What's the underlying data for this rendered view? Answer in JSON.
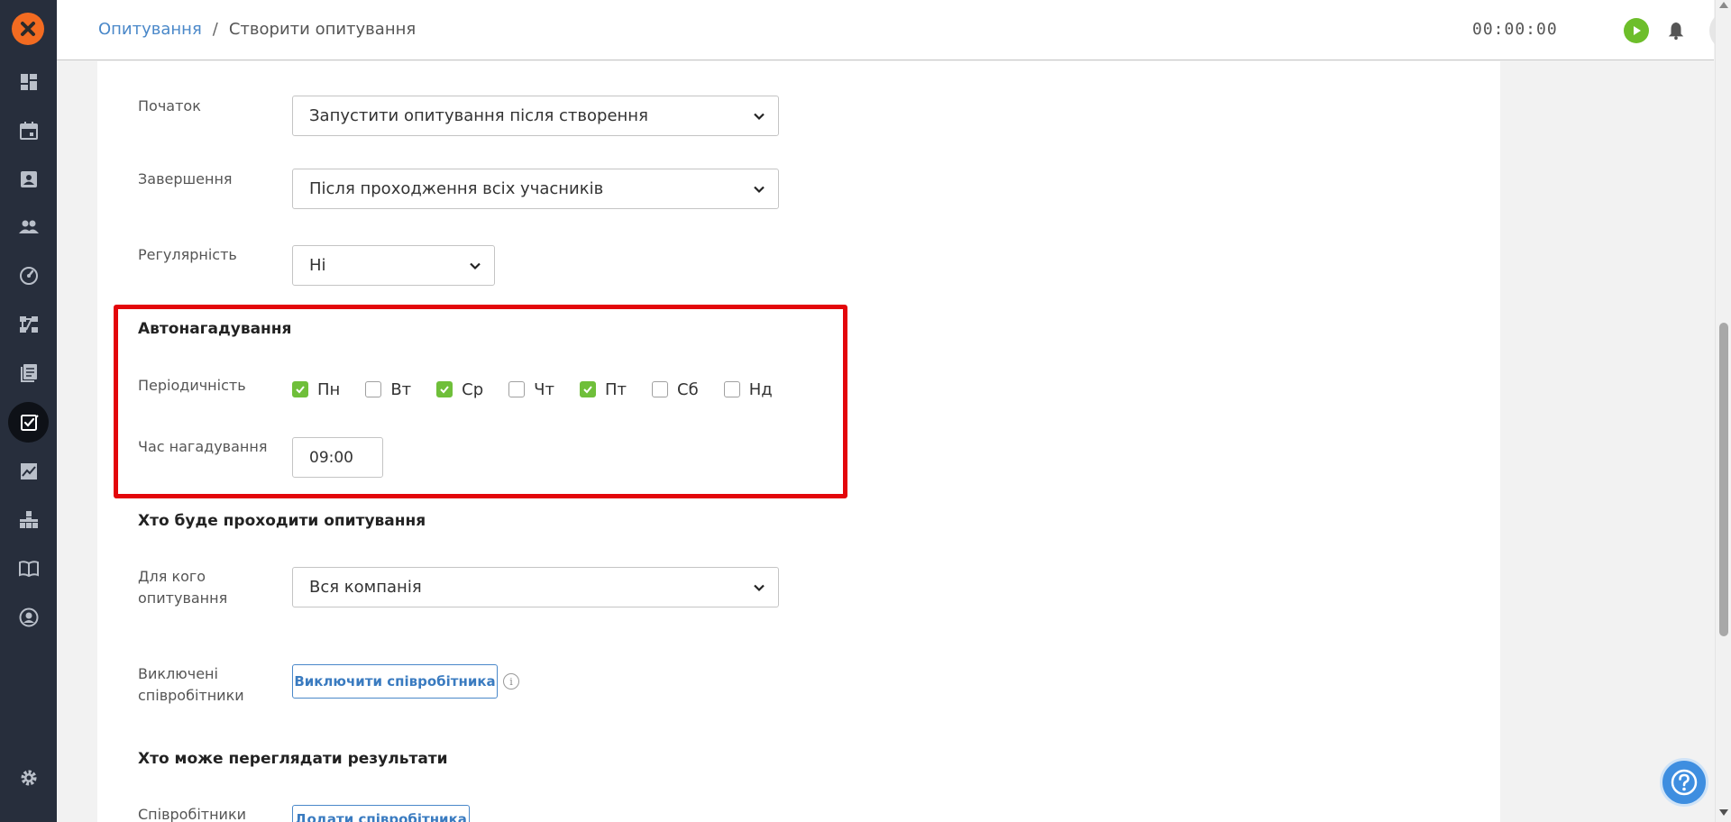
{
  "header": {
    "breadcrumb_link": "Опитування",
    "breadcrumb_sep": "/",
    "breadcrumb_current": "Створити опитування",
    "timer": "00:00:00"
  },
  "sidebar": {
    "items": [
      {
        "icon": "dashboard-icon"
      },
      {
        "icon": "calendar-icon"
      },
      {
        "icon": "contacts-icon"
      },
      {
        "icon": "people-icon"
      },
      {
        "icon": "speedometer-icon"
      },
      {
        "icon": "workflow-icon"
      },
      {
        "icon": "library-icon"
      },
      {
        "icon": "survey-icon",
        "active": true
      },
      {
        "icon": "analytics-icon"
      },
      {
        "icon": "org-structure-icon"
      },
      {
        "icon": "book-icon"
      },
      {
        "icon": "profile-icon"
      },
      {
        "icon": "settings-icon"
      }
    ]
  },
  "form": {
    "start": {
      "label": "Початок",
      "value": "Запустити опитування після створення"
    },
    "finish": {
      "label": "Завершення",
      "value": "Після проходження всіх учасників"
    },
    "regularity": {
      "label": "Регулярність",
      "value": "Ні"
    },
    "autoreminder": {
      "title": "Автонагадування",
      "periodicity_label": "Періодичність",
      "days": [
        {
          "label": "Пн",
          "checked": true
        },
        {
          "label": "Вт",
          "checked": false
        },
        {
          "label": "Ср",
          "checked": true
        },
        {
          "label": "Чт",
          "checked": false
        },
        {
          "label": "Пт",
          "checked": true
        },
        {
          "label": "Сб",
          "checked": false
        },
        {
          "label": "Нд",
          "checked": false
        }
      ],
      "time_label": "Час нагадування",
      "time_value": "09:00"
    },
    "participants": {
      "title": "Хто буде проходити опитування",
      "for_whom_label_1": "Для кого",
      "for_whom_label_2": "опитування",
      "for_whom_value": "Вся компанія",
      "excluded_label_1": "Виключені",
      "excluded_label_2": "співробітники",
      "exclude_button": "Виключити співробітника",
      "info_glyph": "i"
    },
    "viewers": {
      "title": "Хто може переглядати результати",
      "employees_label": "Співробітники",
      "add_button": "Додати співробітника"
    }
  },
  "colors": {
    "accent": "#4a88c9",
    "check": "#6fbf3a",
    "highlight": "#e3060b",
    "sidebar": "#272e3c",
    "logo": "#f26b21"
  }
}
